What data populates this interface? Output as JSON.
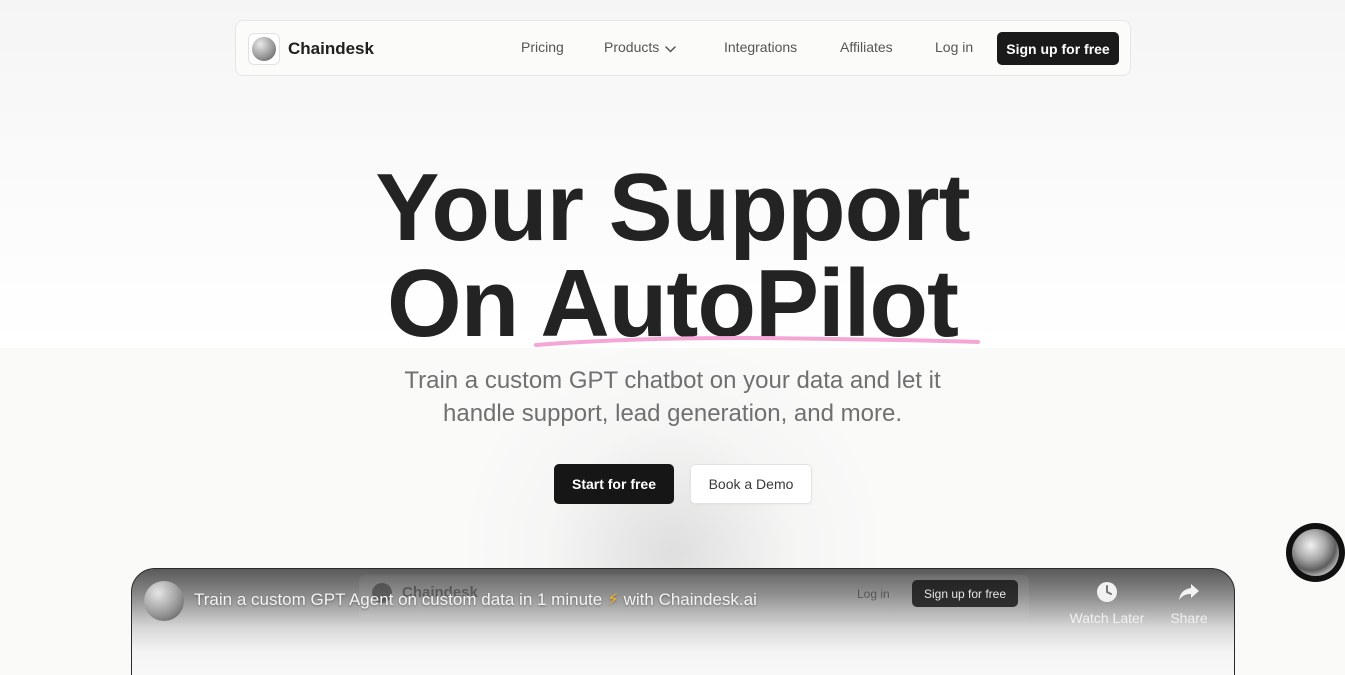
{
  "brand": {
    "name": "Chaindesk"
  },
  "nav": {
    "pricing": "Pricing",
    "products": "Products",
    "integrations": "Integrations",
    "affiliates": "Affiliates",
    "login": "Log in",
    "signup": "Sign up for free"
  },
  "hero": {
    "title_line1": "Your Support",
    "title_line2": "On AutoPilot",
    "subtitle_line1": "Train a custom GPT chatbot on your data and let it",
    "subtitle_line2": "handle support, lead generation, and more.",
    "start_button": "Start for free",
    "demo_button": "Book a Demo"
  },
  "video": {
    "title_before": "Train a custom GPT Agent on custom data in 1 minute",
    "title_after": "with Chaindesk.ai",
    "bolt": "⚡",
    "watch_later": "Watch Later",
    "share": "Share",
    "ghost_brand": "Chaindesk",
    "ghost_login": "Log in",
    "ghost_signup": "Sign up for free"
  },
  "colors": {
    "primary_button": "#161616",
    "underline_accent": "#f4a6d7",
    "text_dark": "#232323",
    "text_muted": "#707070"
  },
  "icons": {
    "products_dropdown": "chevron-down-icon",
    "watch_later": "clock-icon",
    "share": "share-arrow-icon"
  }
}
